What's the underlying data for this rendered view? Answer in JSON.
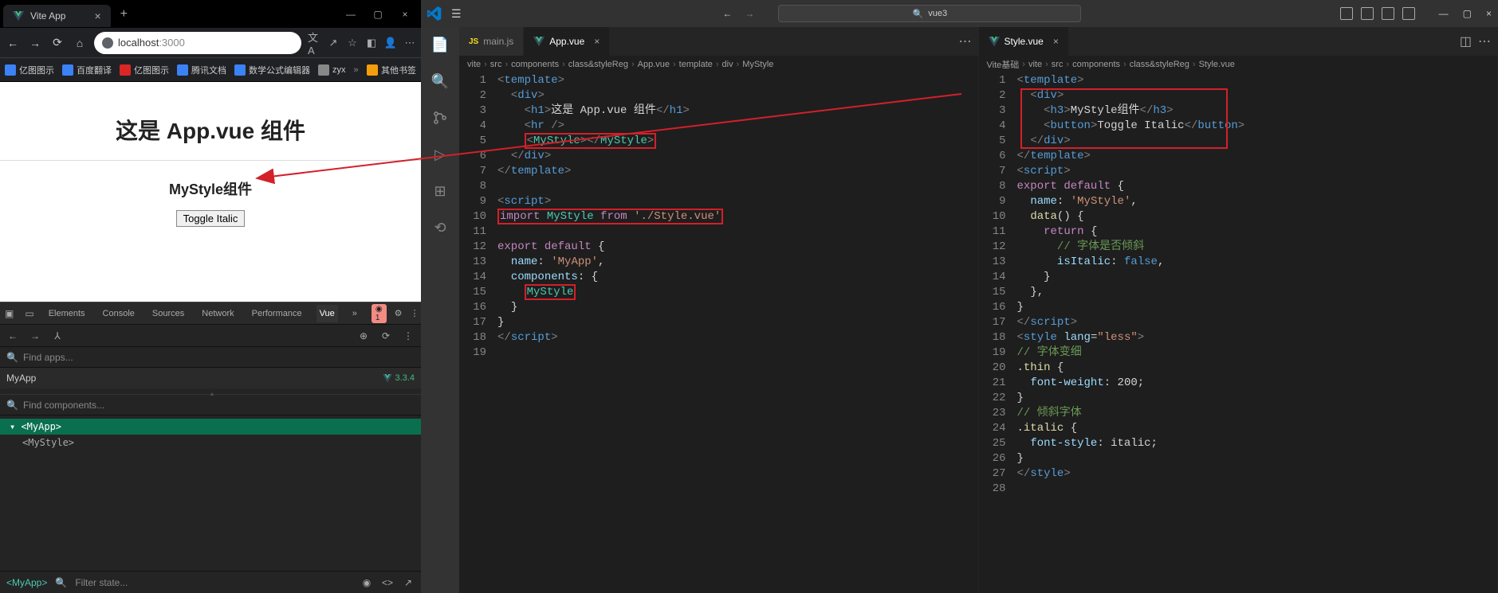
{
  "browser": {
    "tab_title": "Vite App",
    "url_host": "localhost",
    "url_port": ":3000",
    "bookmarks": [
      {
        "label": "亿图图示"
      },
      {
        "label": "百度翻译"
      },
      {
        "label": "亿图图示"
      },
      {
        "label": "腾讯文档"
      },
      {
        "label": "数学公式编辑器"
      },
      {
        "label": "zyx"
      },
      {
        "label": "其他书签"
      }
    ],
    "page": {
      "h1": "这是 App.vue 组件",
      "h3": "MyStyle组件",
      "button": "Toggle Italic"
    }
  },
  "devtools": {
    "tabs": [
      "Elements",
      "Console",
      "Sources",
      "Network",
      "Performance",
      "Vue"
    ],
    "active_tab": "Vue",
    "error_badge": "1",
    "find_apps_placeholder": "Find apps...",
    "app_name": "MyApp",
    "vue_version": "3.3.4",
    "find_components_placeholder": "Find components...",
    "tree_root": "<MyApp>",
    "tree_child": "<MyStyle>",
    "path": "<MyApp>",
    "filter_placeholder": "Filter state..."
  },
  "vscode": {
    "search_text": "vue3",
    "editor1": {
      "tabs": [
        {
          "label": "main.js",
          "active": false,
          "type": "js"
        },
        {
          "label": "App.vue",
          "active": true,
          "type": "vue"
        }
      ],
      "breadcrumb": [
        "vite",
        "src",
        "components",
        "class&styleReg",
        "App.vue",
        "template",
        "div",
        "MyStyle"
      ],
      "lines": [
        {
          "n": 1,
          "html": "<span class='tg'>&lt;</span><span class='tn'>template</span><span class='tg'>&gt;</span>"
        },
        {
          "n": 2,
          "html": "  <span class='tg'>&lt;</span><span class='tn'>div</span><span class='tg'>&gt;</span>"
        },
        {
          "n": 3,
          "html": "    <span class='tg'>&lt;</span><span class='tn'>h1</span><span class='tg'>&gt;</span><span class='tx'>这是 App.vue 组件</span><span class='tg'>&lt;/</span><span class='tn'>h1</span><span class='tg'>&gt;</span>"
        },
        {
          "n": 4,
          "html": "    <span class='tg'>&lt;</span><span class='tn'>hr</span> <span class='tg'>/&gt;</span>"
        },
        {
          "n": 5,
          "html": "    <span class='hl-red'><span class='tg'>&lt;</span><span class='cmp'>MyStyle</span><span class='tg'>&gt;&lt;/</span><span class='cmp'>MyStyle</span><span class='tg'>&gt;</span></span>"
        },
        {
          "n": 6,
          "html": "  <span class='tg'>&lt;/</span><span class='tn'>div</span><span class='tg'>&gt;</span>"
        },
        {
          "n": 7,
          "html": "<span class='tg'>&lt;/</span><span class='tn'>template</span><span class='tg'>&gt;</span>"
        },
        {
          "n": 8,
          "html": ""
        },
        {
          "n": 9,
          "html": "<span class='tg'>&lt;</span><span class='tn'>script</span><span class='tg'>&gt;</span>"
        },
        {
          "n": 10,
          "html": "<span class='hl-red'><span class='kw'>import</span> <span class='va'>MyStyle</span> <span class='kw'>from</span> <span class='st'>'./Style.vue'</span></span>"
        },
        {
          "n": 11,
          "html": ""
        },
        {
          "n": 12,
          "html": "<span class='kw'>export</span> <span class='kw'>default</span> <span class='tx'>{</span>"
        },
        {
          "n": 13,
          "html": "  <span class='pr'>name</span><span class='tx'>: </span><span class='st'>'MyApp'</span><span class='tx'>,</span>"
        },
        {
          "n": 14,
          "html": "  <span class='pr'>components</span><span class='tx'>: {</span>"
        },
        {
          "n": 15,
          "html": "    <span class='hl-red'><span class='va'>MyStyle</span></span>"
        },
        {
          "n": 16,
          "html": "  <span class='tx'>}</span>"
        },
        {
          "n": 17,
          "html": "<span class='tx'>}</span>"
        },
        {
          "n": 18,
          "html": "<span class='tg'>&lt;/</span><span class='tn'>script</span><span class='tg'>&gt;</span>"
        },
        {
          "n": 19,
          "html": ""
        }
      ]
    },
    "editor2": {
      "tabs": [
        {
          "label": "Style.vue",
          "active": true,
          "type": "vue"
        }
      ],
      "breadcrumb": [
        "Vite基础",
        "vite",
        "src",
        "components",
        "class&styleReg",
        "Style.vue"
      ],
      "lines": [
        {
          "n": 1,
          "html": "<span class='tg'>&lt;</span><span class='tn'>template</span><span class='tg'>&gt;</span>"
        },
        {
          "n": 2,
          "html": "  <span class='tg'>&lt;</span><span class='tn'>div</span><span class='tg'>&gt;</span>"
        },
        {
          "n": 3,
          "html": "    <span class='tg'>&lt;</span><span class='tn'>h3</span><span class='tg'>&gt;</span><span class='tx'>MyStyle组件</span><span class='tg'>&lt;/</span><span class='tn'>h3</span><span class='tg'>&gt;</span>"
        },
        {
          "n": 4,
          "html": "    <span class='tg'>&lt;</span><span class='tn'>button</span><span class='tg'>&gt;</span><span class='tx'>Toggle Italic</span><span class='tg'>&lt;/</span><span class='tn'>button</span><span class='tg'>&gt;</span>"
        },
        {
          "n": 5,
          "html": "  <span class='tg'>&lt;/</span><span class='tn'>div</span><span class='tg'>&gt;</span>"
        },
        {
          "n": 6,
          "html": "<span class='tg'>&lt;/</span><span class='tn'>template</span><span class='tg'>&gt;</span>"
        },
        {
          "n": 7,
          "html": "<span class='tg'>&lt;</span><span class='tn'>script</span><span class='tg'>&gt;</span>"
        },
        {
          "n": 8,
          "html": "<span class='kw'>export</span> <span class='kw'>default</span> <span class='tx'>{</span>"
        },
        {
          "n": 9,
          "html": "  <span class='pr'>name</span><span class='tx'>: </span><span class='st'>'MyStyle'</span><span class='tx'>,</span>"
        },
        {
          "n": 10,
          "html": "  <span class='fn'>data</span><span class='tx'>() {</span>"
        },
        {
          "n": 11,
          "html": "    <span class='kw'>return</span> <span class='tx'>{</span>"
        },
        {
          "n": 12,
          "html": "      <span class='cm'>// 字体是否倾斜</span>"
        },
        {
          "n": 13,
          "html": "      <span class='pr'>isItalic</span><span class='tx'>: </span><span class='kw2'>false</span><span class='tx'>,</span>"
        },
        {
          "n": 14,
          "html": "    <span class='tx'>}</span>"
        },
        {
          "n": 15,
          "html": "  <span class='tx'>},</span>"
        },
        {
          "n": 16,
          "html": "<span class='tx'>}</span>"
        },
        {
          "n": 17,
          "html": "<span class='tg'>&lt;/</span><span class='tn'>script</span><span class='tg'>&gt;</span>"
        },
        {
          "n": 18,
          "html": "<span class='tg'>&lt;</span><span class='tn'>style</span> <span class='at'>lang</span><span class='tx'>=</span><span class='st'>\"less\"</span><span class='tg'>&gt;</span>"
        },
        {
          "n": 19,
          "html": "<span class='cm'>// 字体变细</span>"
        },
        {
          "n": 20,
          "html": "<span class='fn'>.thin</span> <span class='tx'>{</span>"
        },
        {
          "n": 21,
          "html": "  <span class='pr'>font-weight</span><span class='tx'>: </span><span class='tx'>200;</span>"
        },
        {
          "n": 22,
          "html": "<span class='tx'>}</span>"
        },
        {
          "n": 23,
          "html": "<span class='cm'>// 倾斜字体</span>"
        },
        {
          "n": 24,
          "html": "<span class='fn'>.italic</span> <span class='tx'>{</span>"
        },
        {
          "n": 25,
          "html": "  <span class='pr'>font-style</span><span class='tx'>: italic;</span>"
        },
        {
          "n": 26,
          "html": "<span class='tx'>}</span>"
        },
        {
          "n": 27,
          "html": "<span class='tg'>&lt;/</span><span class='tn'>style</span><span class='tg'>&gt;</span>"
        },
        {
          "n": 28,
          "html": ""
        }
      ]
    }
  }
}
